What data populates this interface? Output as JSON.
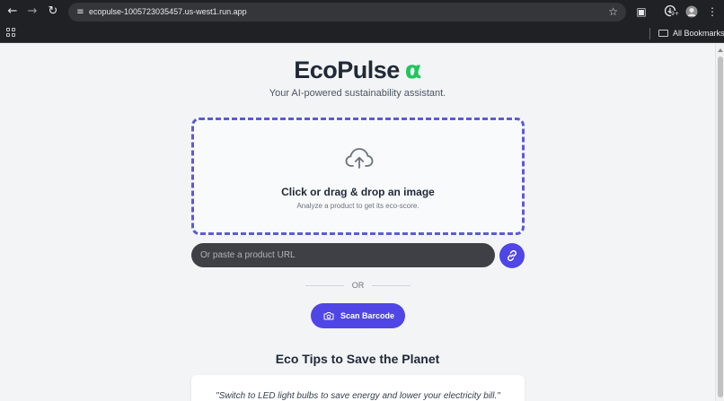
{
  "browser": {
    "url": "ecopulse-1005723035457.us-west1.run.app",
    "bookmarks_label": "All Bookmarks",
    "downloads_badge": "9+"
  },
  "header": {
    "brand": "EcoPulse",
    "brand_suffix": "α",
    "tagline": "Your AI-powered sustainability assistant."
  },
  "upload": {
    "title": "Click or drag & drop an image",
    "subtitle": "Analyze a product to get its eco-score."
  },
  "url_input": {
    "placeholder": "Or paste a product URL",
    "value": ""
  },
  "divider": {
    "label": "OR"
  },
  "scan": {
    "label": "Scan Barcode"
  },
  "tips": {
    "title": "Eco Tips to Save the Planet",
    "current": "\"Switch to LED light bulbs to save energy and lower your electricity bill.\""
  },
  "colors": {
    "accent": "#4f46e5",
    "brand_alpha": "#22c55e",
    "dashed_border": "#5b5bd6",
    "background": "#f3f4f6"
  },
  "icons": [
    "back-arrow-icon",
    "forward-arrow-icon",
    "reload-icon",
    "site-info-icon",
    "star-icon",
    "extensions-icon",
    "downloads-icon",
    "profile-avatar-icon",
    "kebab-menu-icon",
    "apps-grid-icon",
    "folder-icon",
    "cloud-upload-icon",
    "link-icon",
    "camera-icon"
  ]
}
